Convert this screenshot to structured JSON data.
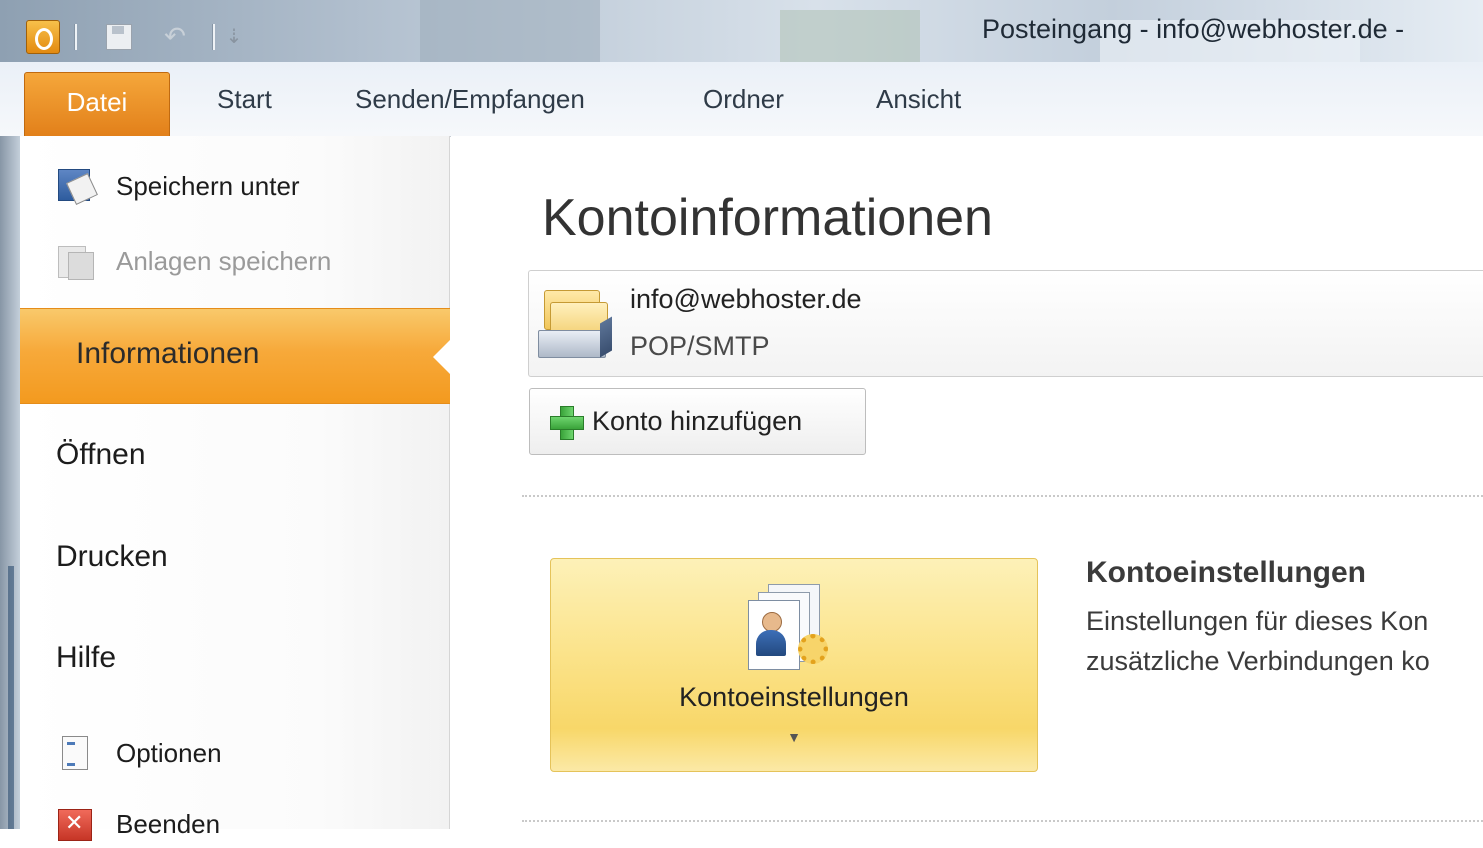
{
  "window": {
    "title": "Posteingang - info@webhoster.de -"
  },
  "ribbon": {
    "tabs": [
      {
        "label": "Datei",
        "active": true
      },
      {
        "label": "Start"
      },
      {
        "label": "Senden/Empfangen"
      },
      {
        "label": "Ordner"
      },
      {
        "label": "Ansicht"
      }
    ]
  },
  "backstage_nav": {
    "commands": [
      {
        "label": "Speichern unter",
        "icon": "save-as-icon",
        "enabled": true
      },
      {
        "label": "Anlagen speichern",
        "icon": "save-attachments-icon",
        "enabled": false
      }
    ],
    "tabs": [
      {
        "label": "Informationen",
        "selected": true
      },
      {
        "label": "Öffnen"
      },
      {
        "label": "Drucken"
      },
      {
        "label": "Hilfe"
      }
    ],
    "bottom_commands": [
      {
        "label": "Optionen",
        "icon": "options-icon"
      },
      {
        "label": "Beenden",
        "icon": "exit-icon"
      }
    ]
  },
  "main": {
    "title": "Kontoinformationen",
    "account": {
      "email": "info@webhoster.de",
      "type": "POP/SMTP",
      "icon": "account-folder-icon"
    },
    "add_account_label": "Konto hinzufügen",
    "account_settings": {
      "button_label": "Kontoeinstellungen",
      "heading": "Kontoeinstellungen",
      "description_line1": "Einstellungen für dieses Kon",
      "description_line2": "zusätzliche Verbindungen ko"
    }
  },
  "colors": {
    "accent_orange": "#F39A1F",
    "highlight_yellow": "#FBE38A",
    "plus_green": "#3AA33A"
  }
}
